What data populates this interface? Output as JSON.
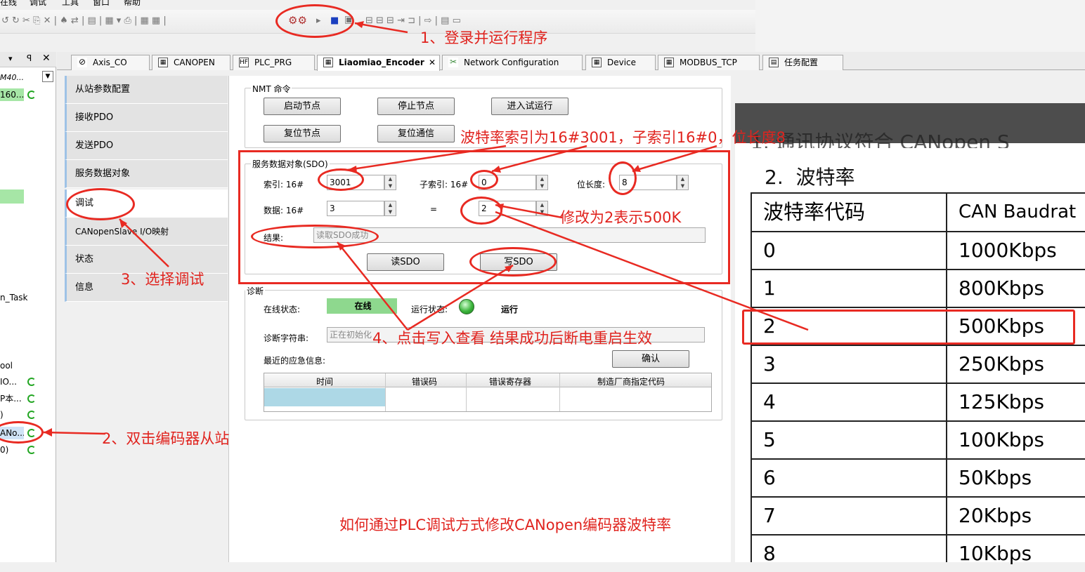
{
  "menu": [
    "在线",
    "调试",
    "工具",
    "窗口",
    "帮助"
  ],
  "tabs": [
    {
      "label": "Axis_CO",
      "icon": "axis-icon"
    },
    {
      "label": "CANOPEN",
      "icon": "grid-icon"
    },
    {
      "label": "PLC_PRG",
      "icon": "program-icon"
    },
    {
      "label": "Liaomiao_Encoder",
      "icon": "grid-icon"
    },
    {
      "label": "Network Configuration",
      "icon": "tools-icon"
    },
    {
      "label": "Device",
      "icon": "grid-icon"
    },
    {
      "label": "MODBUS_TCP",
      "icon": "grid-icon"
    },
    {
      "label": "任务配置",
      "icon": "task-icon"
    }
  ],
  "tree": [
    "M40...",
    "160...",
    "n_Task",
    "ool",
    "IO...",
    "P本...",
    ")",
    "ANo...",
    "0)"
  ],
  "nav": [
    "从站参数配置",
    "接收PDO",
    "发送PDO",
    "服务数据对象",
    "调试",
    "CANopenSlave I/O映射",
    "状态",
    "信息"
  ],
  "nmt": {
    "title": "NMT 命令",
    "start": "启动节点",
    "stop": "停止节点",
    "preop": "进入试运行",
    "reset_node": "复位节点",
    "reset_comm": "复位通信"
  },
  "sdo": {
    "title": "服务数据对象(SDO)",
    "index_label": "索引: 16#",
    "index_value": "3001",
    "subindex_label": "子索引: 16#",
    "subindex_value": "0",
    "bitlen_label": "位长度:",
    "bitlen_value": "8",
    "data_label": "数据: 16#",
    "data_value": "3",
    "equals": "=",
    "data2_value": "2",
    "result_label": "结果:",
    "result_value": "读取SDO成功",
    "read": "读SDO",
    "write": "写SDO"
  },
  "diag": {
    "title": "诊断",
    "online_label": "在线状态:",
    "online_value": "在线",
    "run_label": "运行状态:",
    "run_value": "运行",
    "string_label": "诊断字符串:",
    "string_value": "正在初始化",
    "emcy_label": "最近的应急信息:",
    "confirm": "确认",
    "columns": [
      "时间",
      "错误码",
      "错误寄存器",
      "制造厂商指定代码"
    ]
  },
  "doc": {
    "heading_partial": "1. 通讯协议符合 CANopen S",
    "heading": "2.  波特率",
    "col1": "波特率代码",
    "col2": "CAN Baudrat",
    "rows": [
      [
        "0",
        "1000Kbps"
      ],
      [
        "1",
        "800Kbps"
      ],
      [
        "2",
        "500Kbps"
      ],
      [
        "3",
        "250Kbps"
      ],
      [
        "4",
        "125Kbps"
      ],
      [
        "5",
        "100Kbps"
      ],
      [
        "6",
        "50Kbps"
      ],
      [
        "7",
        "20Kbps"
      ],
      [
        "8",
        "10Kbps"
      ]
    ]
  },
  "annotations": {
    "a1": "1、登录并运行程序",
    "a2": "2、双击编码器从站",
    "a3": "3、选择调试",
    "a4": "4、点击写入查看 结果成功后断电重启生效",
    "baud": "波特率索引为16#3001，子索引16#0，位长度8",
    "modify": "修改为2表示500K",
    "footer": "如何通过PLC调试方式修改CANopen编码器波特率"
  },
  "colors": {
    "annotation": "#e0231e",
    "online": "#8ed88e",
    "selected_tree": "#a6e6a6",
    "table_cell": "#add8e6"
  }
}
